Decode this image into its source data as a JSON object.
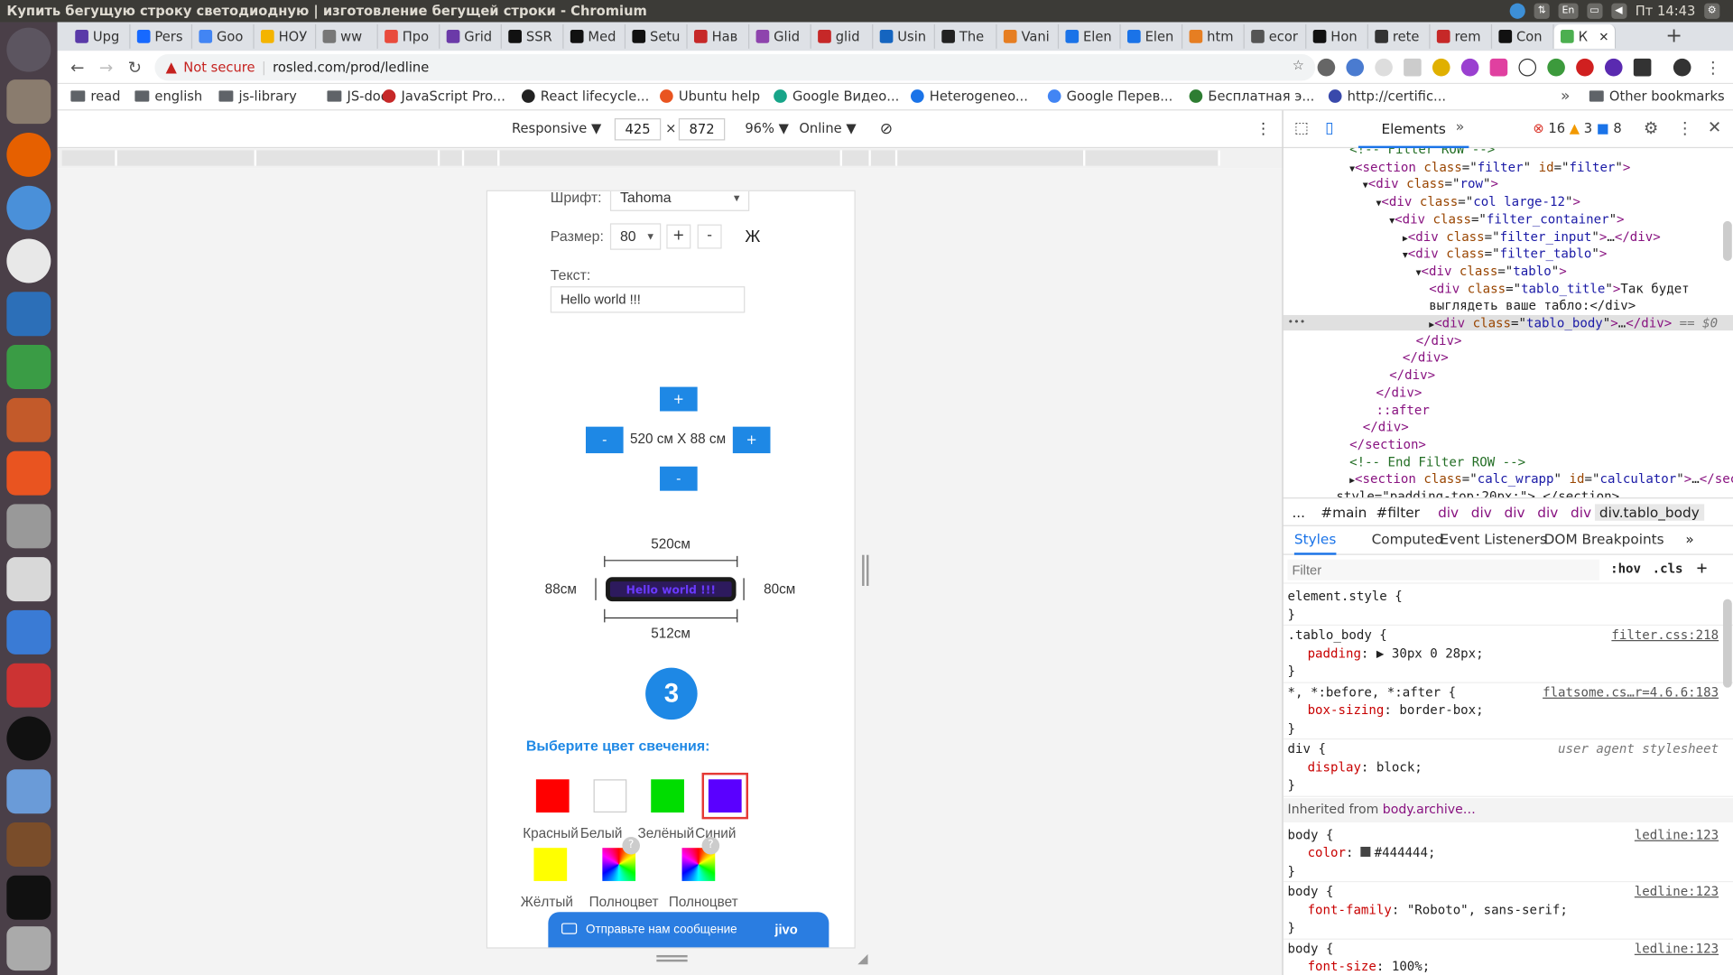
{
  "window_title": "Купить бегущую строку светодиодную | изготовление бегущей строки - Chromium",
  "system": {
    "lang": "En",
    "clock": "Пт 14:43"
  },
  "tabs": [
    "Upg",
    "Pers",
    "Goo",
    "НОУ",
    "ww",
    "Про",
    "Grid",
    "SSR",
    "Med",
    "Setu",
    "Нав",
    "Glid",
    "glid",
    "Usin",
    "The",
    "Vani",
    "Elen",
    "Elen",
    "htm",
    "ecor",
    "Hon",
    "rete",
    "rem",
    "Con",
    "К"
  ],
  "address": {
    "security": "Not secure",
    "url": "rosled.com/prod/ledline"
  },
  "bookmarks": [
    "read",
    "english",
    "js-library",
    "JS-doc",
    "JavaScript Pro...",
    "React lifecycle...",
    "Ubuntu help",
    "Google Видео...",
    "Heterogeneo...",
    "Google Перев...",
    "Бесплатная э...",
    "http://certific...",
    "Other bookmarks"
  ],
  "device_toolbar": {
    "mode": "Responsive",
    "width": "425",
    "height": "872",
    "zoom": "96%",
    "network": "Online",
    "times": "×"
  },
  "page": {
    "font_label": "Шрифт:",
    "font_value": "Tahoma",
    "size_label": "Размер:",
    "size_value": "80",
    "plus": "+",
    "minus": "-",
    "bold": "Ж",
    "text_label": "Текст:",
    "text_value": "Hello world !!!",
    "dim_text": "520 см X 88 см",
    "top_width": "520см",
    "bottom_width": "512см",
    "left_height": "88см",
    "right_height": "80см",
    "step": "3",
    "color_heading": "Выберите цвет свечения:",
    "colors": [
      {
        "name": "Красный",
        "hex": "#ff0000"
      },
      {
        "name": "Белый",
        "hex": "#ffffff"
      },
      {
        "name": "Зелёный",
        "hex": "#00dd00"
      },
      {
        "name": "Синий",
        "hex": "#5a00ff"
      },
      {
        "name": "Жёлтый",
        "hex": "#ffff00"
      },
      {
        "name": "Полноцвет",
        "hex": "multicolor"
      },
      {
        "name": "Полноцвет",
        "hex": "multicolor"
      }
    ],
    "selected_color": "Синий",
    "chat": "Отправьте нам сообщение",
    "chat_brand": "jivo"
  },
  "devtools": {
    "panel": "Elements",
    "errors": "16",
    "warnings": "3",
    "messages": "8",
    "dom": [
      {
        "indent": 5,
        "type": "comment",
        "text": "<!-- Filter ROW -->"
      },
      {
        "indent": 5,
        "type": "open",
        "arrow": "▼",
        "tag": "section",
        "attrs": [
          [
            "class",
            "filter"
          ],
          [
            "id",
            "filter"
          ]
        ]
      },
      {
        "indent": 6,
        "type": "open",
        "arrow": "▼",
        "tag": "div",
        "attrs": [
          [
            "class",
            "row"
          ]
        ]
      },
      {
        "indent": 7,
        "type": "open",
        "arrow": "▼",
        "tag": "div",
        "attrs": [
          [
            "class",
            "col large-12"
          ]
        ]
      },
      {
        "indent": 8,
        "type": "open",
        "arrow": "▼",
        "tag": "div",
        "attrs": [
          [
            "class",
            "filter_container"
          ]
        ]
      },
      {
        "indent": 9,
        "type": "collapsed",
        "arrow": "▶",
        "tag": "div",
        "attrs": [
          [
            "class",
            "filter_input"
          ]
        ]
      },
      {
        "indent": 9,
        "type": "open",
        "arrow": "▼",
        "tag": "div",
        "attrs": [
          [
            "class",
            "filter_tablo"
          ]
        ]
      },
      {
        "indent": 10,
        "type": "open",
        "arrow": "▼",
        "tag": "div",
        "attrs": [
          [
            "class",
            "tablo"
          ]
        ]
      },
      {
        "indent": 11,
        "type": "textnode",
        "tag": "div",
        "attrs": [
          [
            "class",
            "tablo_title"
          ]
        ],
        "text": "Так будет"
      },
      {
        "indent": 11,
        "type": "plain",
        "text": "выглядеть ваше табло:</div>"
      },
      {
        "indent": 11,
        "type": "selected",
        "arrow": "▶",
        "tag": "div",
        "attrs": [
          [
            "class",
            "tablo_body"
          ]
        ],
        "suffix": " == $0"
      },
      {
        "indent": 10,
        "type": "close",
        "text": "</div>"
      },
      {
        "indent": 9,
        "type": "close",
        "text": "</div>"
      },
      {
        "indent": 8,
        "type": "close",
        "text": "</div>"
      },
      {
        "indent": 7,
        "type": "close",
        "text": "</div>"
      },
      {
        "indent": 7,
        "type": "pseudo",
        "text": "::after"
      },
      {
        "indent": 6,
        "type": "close",
        "text": "</div>"
      },
      {
        "indent": 5,
        "type": "close",
        "text": "</section>"
      },
      {
        "indent": 5,
        "type": "comment",
        "text": "<!-- End Filter ROW -->"
      },
      {
        "indent": 5,
        "type": "collapsed",
        "arrow": "▶",
        "tag": "section",
        "attrs": [
          [
            "class",
            "calc_wrapp"
          ],
          [
            "id",
            "calculator"
          ]
        ]
      },
      {
        "indent": 4,
        "type": "plain",
        "text": "style=\"padding-top:20px;\">…</section>"
      }
    ],
    "breadcrumbs": [
      "...",
      "#main",
      "#filter",
      "div",
      "div",
      "div",
      "div",
      "div",
      "div.tablo_body"
    ],
    "side_tabs": [
      "Styles",
      "Computed",
      "Event Listeners",
      "DOM Breakpoints"
    ],
    "filter_placeholder": "Filter",
    "hov": ":hov",
    "cls": ".cls",
    "rules": [
      {
        "selector": "element.style {",
        "src": "",
        "props": []
      },
      {
        "selector": ".tablo_body {",
        "src": "filter.css:218",
        "props": [
          [
            "padding",
            "▶ 30px 0 28px;"
          ]
        ]
      },
      {
        "selector": "*, *:before, *:after {",
        "src": "flatsome.cs…r=4.6.6:183",
        "props": [
          [
            "box-sizing",
            "border-box;"
          ]
        ]
      },
      {
        "selector": "div {",
        "src": "user agent stylesheet",
        "props": [
          [
            "display",
            "block;"
          ]
        ]
      }
    ],
    "inherited_label": "Inherited from",
    "inherited_from": "body.archive…",
    "body_rules": [
      {
        "selector": "body {",
        "src": "ledline:123",
        "props": [
          [
            "color",
            "#444444;"
          ]
        ]
      },
      {
        "selector": "body {",
        "src": "ledline:123",
        "props": [
          [
            "font-family",
            "\"Roboto\", sans-serif;"
          ]
        ]
      },
      {
        "selector": "body {",
        "src": "ledline:123",
        "props": [
          [
            "font-size",
            "100%;"
          ]
        ]
      }
    ]
  }
}
